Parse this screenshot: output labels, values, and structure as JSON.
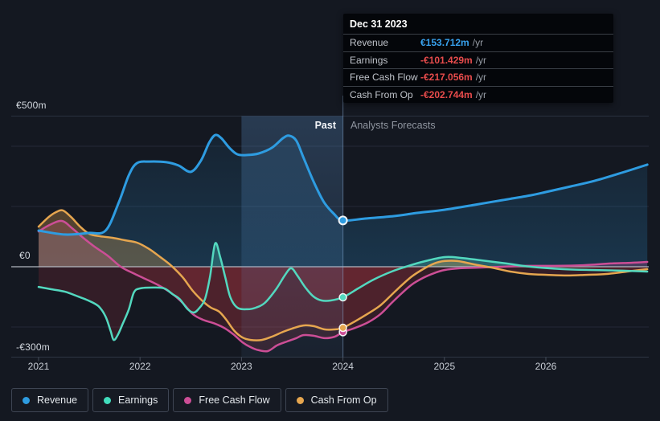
{
  "tooltip": {
    "title": "Dec 31 2023",
    "rows": [
      {
        "label": "Revenue",
        "value": "€153.712m",
        "unit": "/yr",
        "color": "#38a2ef"
      },
      {
        "label": "Earnings",
        "value": "-€101.429m",
        "unit": "/yr",
        "color": "#e84c4c"
      },
      {
        "label": "Free Cash Flow",
        "value": "-€217.056m",
        "unit": "/yr",
        "color": "#e84c4c"
      },
      {
        "label": "Cash From Op",
        "value": "-€202.744m",
        "unit": "/yr",
        "color": "#e84c4c"
      }
    ]
  },
  "chart_annotations": {
    "past_label": "Past",
    "forecast_label": "Analysts Forecasts"
  },
  "axes": {
    "y_labels": [
      {
        "text": "€500m",
        "value": 500
      },
      {
        "text": "€0",
        "value": 0
      },
      {
        "text": "-€300m",
        "value": -300
      }
    ],
    "x_ticks": [
      "2021",
      "2022",
      "2023",
      "2024",
      "2025",
      "2026"
    ]
  },
  "legend": [
    {
      "label": "Revenue",
      "color": "#2e9ce1"
    },
    {
      "label": "Earnings",
      "color": "#41dcbc"
    },
    {
      "label": "Free Cash Flow",
      "color": "#cc4e96"
    },
    {
      "label": "Cash From Op",
      "color": "#e6a64f"
    }
  ],
  "chart_data": {
    "type": "area",
    "unit": "EUR millions per year",
    "xlim": [
      2020.73,
      2027.0
    ],
    "ylim": [
      -300,
      500
    ],
    "gridline_values": [
      400,
      200,
      -200
    ],
    "boundary_values": [
      500,
      -300
    ],
    "zero_line": 0,
    "divider_x": 2024.0,
    "highlight_band": [
      2023.0,
      2024.0
    ],
    "series": [
      {
        "name": "Revenue",
        "color": "#2e9ce1",
        "marker_value": 153.712,
        "points": [
          [
            2021.0,
            120
          ],
          [
            2021.26,
            107
          ],
          [
            2021.49,
            112
          ],
          [
            2021.66,
            120
          ],
          [
            2021.79,
            213
          ],
          [
            2021.89,
            304
          ],
          [
            2021.97,
            344
          ],
          [
            2022.09,
            349
          ],
          [
            2022.26,
            347
          ],
          [
            2022.38,
            336
          ],
          [
            2022.5,
            315
          ],
          [
            2022.6,
            352
          ],
          [
            2022.68,
            411
          ],
          [
            2022.74,
            437
          ],
          [
            2022.8,
            427
          ],
          [
            2022.88,
            395
          ],
          [
            2022.96,
            373
          ],
          [
            2023.06,
            371
          ],
          [
            2023.17,
            376
          ],
          [
            2023.3,
            395
          ],
          [
            2023.41,
            427
          ],
          [
            2023.47,
            435
          ],
          [
            2023.54,
            419
          ],
          [
            2023.61,
            363
          ],
          [
            2023.71,
            283
          ],
          [
            2023.81,
            216
          ],
          [
            2023.91,
            176
          ],
          [
            2024.0,
            153.712
          ],
          [
            2024.22,
            160
          ],
          [
            2024.5,
            168
          ],
          [
            2024.74,
            179
          ],
          [
            2025.0,
            189
          ],
          [
            2025.29,
            205
          ],
          [
            2025.57,
            221
          ],
          [
            2025.85,
            237
          ],
          [
            2026.0,
            248
          ],
          [
            2026.25,
            267
          ],
          [
            2026.48,
            285
          ],
          [
            2026.72,
            309
          ],
          [
            2027.0,
            339
          ]
        ]
      },
      {
        "name": "Earnings",
        "color": "#53d8bf",
        "marker_value": -101.429,
        "points": [
          [
            2021.0,
            -67
          ],
          [
            2021.13,
            -75
          ],
          [
            2021.26,
            -83
          ],
          [
            2021.39,
            -99
          ],
          [
            2021.49,
            -112
          ],
          [
            2021.59,
            -131
          ],
          [
            2021.66,
            -165
          ],
          [
            2021.71,
            -213
          ],
          [
            2021.74,
            -243
          ],
          [
            2021.78,
            -227
          ],
          [
            2021.83,
            -189
          ],
          [
            2021.89,
            -141
          ],
          [
            2021.94,
            -85
          ],
          [
            2022.0,
            -72
          ],
          [
            2022.13,
            -69
          ],
          [
            2022.24,
            -72
          ],
          [
            2022.32,
            -91
          ],
          [
            2022.39,
            -107
          ],
          [
            2022.47,
            -141
          ],
          [
            2022.53,
            -152
          ],
          [
            2022.58,
            -139
          ],
          [
            2022.64,
            -107
          ],
          [
            2022.69,
            -32
          ],
          [
            2022.74,
            77
          ],
          [
            2022.79,
            32
          ],
          [
            2022.84,
            -35
          ],
          [
            2022.89,
            -101
          ],
          [
            2022.96,
            -136
          ],
          [
            2023.06,
            -141
          ],
          [
            2023.14,
            -136
          ],
          [
            2023.23,
            -120
          ],
          [
            2023.34,
            -75
          ],
          [
            2023.43,
            -27
          ],
          [
            2023.49,
            -5
          ],
          [
            2023.55,
            -29
          ],
          [
            2023.63,
            -69
          ],
          [
            2023.71,
            -99
          ],
          [
            2023.79,
            -112
          ],
          [
            2023.88,
            -112
          ],
          [
            2024.0,
            -101.429
          ],
          [
            2024.15,
            -72
          ],
          [
            2024.3,
            -43
          ],
          [
            2024.48,
            -16
          ],
          [
            2024.62,
            0
          ],
          [
            2024.78,
            16
          ],
          [
            2025.0,
            32
          ],
          [
            2025.17,
            29
          ],
          [
            2025.37,
            21
          ],
          [
            2025.61,
            11
          ],
          [
            2025.85,
            0
          ],
          [
            2026.17,
            -8
          ],
          [
            2026.48,
            -11
          ],
          [
            2026.76,
            -13
          ],
          [
            2027.0,
            -16
          ]
        ]
      },
      {
        "name": "Free Cash Flow",
        "color": "#cc4e96",
        "marker_value": -217.056,
        "points": [
          [
            2021.0,
            117
          ],
          [
            2021.11,
            139
          ],
          [
            2021.23,
            152
          ],
          [
            2021.33,
            128
          ],
          [
            2021.44,
            96
          ],
          [
            2021.55,
            67
          ],
          [
            2021.68,
            37
          ],
          [
            2021.81,
            0
          ],
          [
            2021.93,
            -21
          ],
          [
            2022.05,
            -40
          ],
          [
            2022.18,
            -61
          ],
          [
            2022.31,
            -88
          ],
          [
            2022.42,
            -120
          ],
          [
            2022.52,
            -157
          ],
          [
            2022.62,
            -176
          ],
          [
            2022.74,
            -189
          ],
          [
            2022.84,
            -205
          ],
          [
            2022.93,
            -227
          ],
          [
            2023.01,
            -251
          ],
          [
            2023.09,
            -267
          ],
          [
            2023.17,
            -277
          ],
          [
            2023.26,
            -280
          ],
          [
            2023.35,
            -261
          ],
          [
            2023.45,
            -248
          ],
          [
            2023.54,
            -237
          ],
          [
            2023.61,
            -227
          ],
          [
            2023.71,
            -229
          ],
          [
            2023.82,
            -237
          ],
          [
            2023.92,
            -232
          ],
          [
            2024.0,
            -217.056
          ],
          [
            2024.12,
            -203
          ],
          [
            2024.25,
            -184
          ],
          [
            2024.37,
            -157
          ],
          [
            2024.48,
            -120
          ],
          [
            2024.58,
            -88
          ],
          [
            2024.68,
            -59
          ],
          [
            2024.79,
            -37
          ],
          [
            2024.9,
            -21
          ],
          [
            2025.0,
            -11
          ],
          [
            2025.15,
            -5
          ],
          [
            2025.33,
            -3
          ],
          [
            2025.57,
            0
          ],
          [
            2025.81,
            3
          ],
          [
            2026.09,
            3
          ],
          [
            2026.37,
            5
          ],
          [
            2026.64,
            11
          ],
          [
            2026.84,
            13
          ],
          [
            2027.0,
            16
          ]
        ]
      },
      {
        "name": "Cash From Op",
        "color": "#e6a64f",
        "marker_value": -202.744,
        "points": [
          [
            2021.0,
            133
          ],
          [
            2021.1,
            165
          ],
          [
            2021.17,
            181
          ],
          [
            2021.24,
            187
          ],
          [
            2021.32,
            165
          ],
          [
            2021.41,
            133
          ],
          [
            2021.5,
            109
          ],
          [
            2021.61,
            101
          ],
          [
            2021.73,
            96
          ],
          [
            2021.85,
            88
          ],
          [
            2021.97,
            80
          ],
          [
            2022.09,
            59
          ],
          [
            2022.2,
            32
          ],
          [
            2022.31,
            3
          ],
          [
            2022.42,
            -35
          ],
          [
            2022.52,
            -80
          ],
          [
            2022.62,
            -115
          ],
          [
            2022.7,
            -136
          ],
          [
            2022.78,
            -149
          ],
          [
            2022.85,
            -176
          ],
          [
            2022.93,
            -213
          ],
          [
            2023.01,
            -235
          ],
          [
            2023.09,
            -243
          ],
          [
            2023.2,
            -243
          ],
          [
            2023.3,
            -232
          ],
          [
            2023.41,
            -216
          ],
          [
            2023.5,
            -205
          ],
          [
            2023.61,
            -195
          ],
          [
            2023.71,
            -197
          ],
          [
            2023.82,
            -208
          ],
          [
            2023.92,
            -208
          ],
          [
            2024.0,
            -202.744
          ],
          [
            2024.12,
            -181
          ],
          [
            2024.25,
            -155
          ],
          [
            2024.37,
            -128
          ],
          [
            2024.48,
            -93
          ],
          [
            2024.58,
            -61
          ],
          [
            2024.68,
            -32
          ],
          [
            2024.79,
            -8
          ],
          [
            2024.9,
            11
          ],
          [
            2025.0,
            19
          ],
          [
            2025.13,
            19
          ],
          [
            2025.29,
            8
          ],
          [
            2025.47,
            -3
          ],
          [
            2025.65,
            -16
          ],
          [
            2025.83,
            -24
          ],
          [
            2026.01,
            -27
          ],
          [
            2026.21,
            -29
          ],
          [
            2026.4,
            -27
          ],
          [
            2026.6,
            -24
          ],
          [
            2026.8,
            -16
          ],
          [
            2027.0,
            -8
          ]
        ]
      }
    ]
  }
}
